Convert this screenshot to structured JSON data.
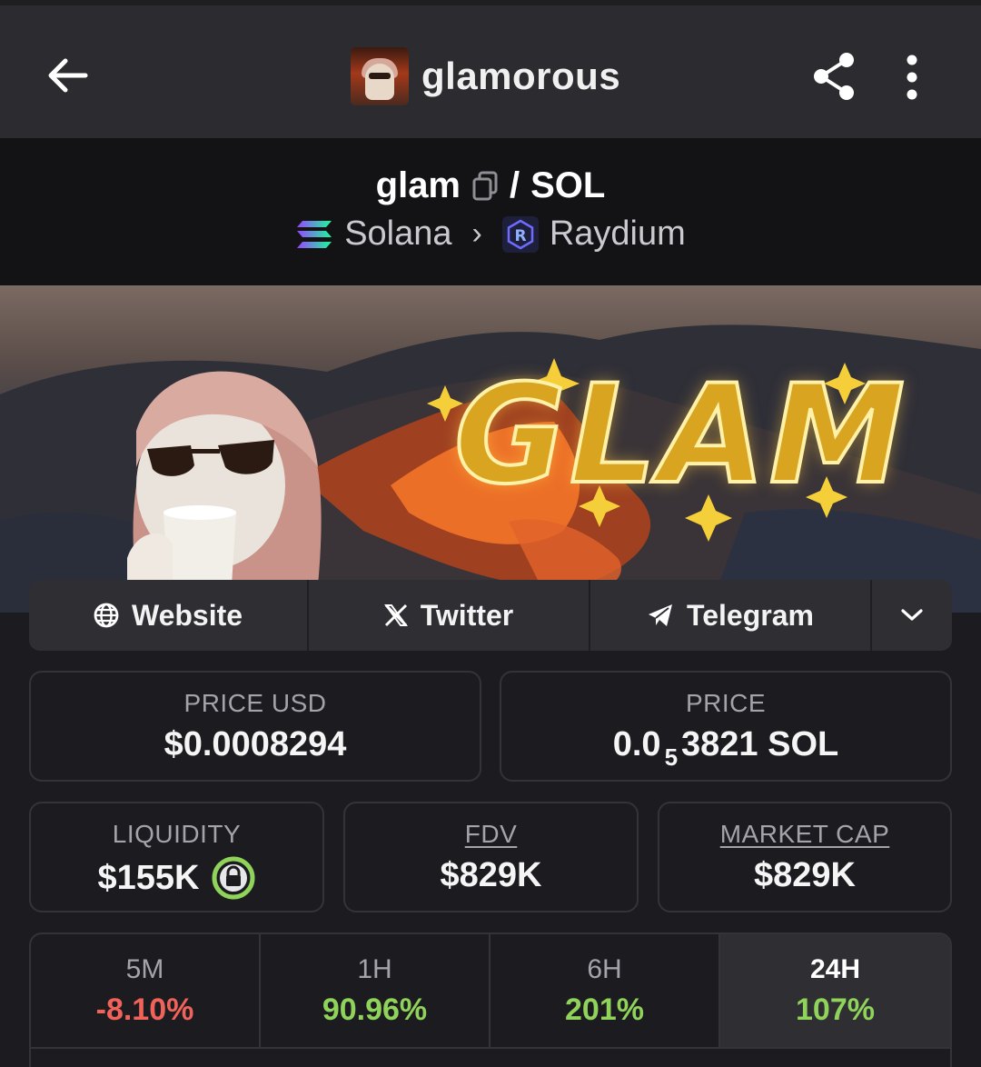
{
  "header": {
    "title": "glamorous",
    "back_icon": "arrow-left-icon",
    "share_icon": "share-icon",
    "more_icon": "more-vertical-icon"
  },
  "pair": {
    "base": "glam",
    "separator": "/",
    "quote": "SOL",
    "chain": "Solana",
    "dex": "Raydium"
  },
  "banner": {
    "text": "GLAM"
  },
  "links": {
    "website": "Website",
    "twitter": "Twitter",
    "telegram": "Telegram"
  },
  "stats": {
    "price_usd_label": "PRICE USD",
    "price_usd_value": "$0.0008294",
    "price_label": "PRICE",
    "price_prefix": "0.0",
    "price_zeros": "5",
    "price_suffix": "3821 SOL",
    "liquidity_label": "LIQUIDITY",
    "liquidity_value": "$155K",
    "fdv_label": "FDV",
    "fdv_value": "$829K",
    "mcap_label": "MARKET CAP",
    "mcap_value": "$829K"
  },
  "timeframes": [
    {
      "period": "5M",
      "change": "-8.10%"
    },
    {
      "period": "1H",
      "change": "90.96%"
    },
    {
      "period": "6H",
      "change": "201%"
    },
    {
      "period": "24H",
      "change": "107%"
    }
  ],
  "colors": {
    "negative": "#f0625a",
    "positive": "#8fd35a",
    "lock_ring": "#8fd35a"
  }
}
